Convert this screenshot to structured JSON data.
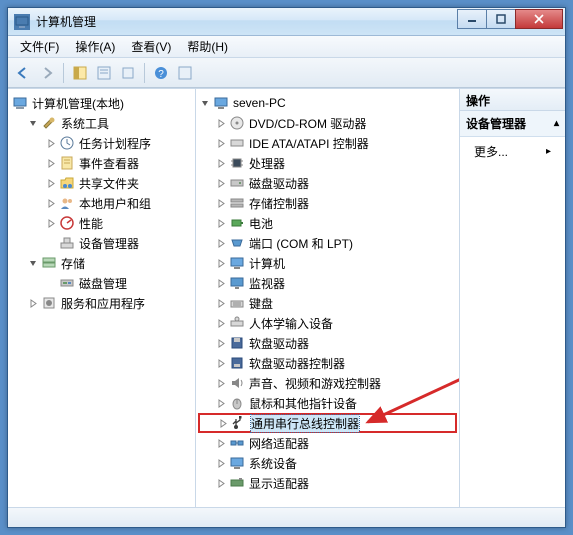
{
  "title": "计算机管理",
  "menu": {
    "file": "文件(F)",
    "action": "操作(A)",
    "view": "查看(V)",
    "help": "帮助(H)"
  },
  "left_tree": {
    "root": "计算机管理(本地)",
    "system_tools": "系统工具",
    "task_scheduler": "任务计划程序",
    "event_viewer": "事件查看器",
    "shared_folders": "共享文件夹",
    "local_users": "本地用户和组",
    "performance": "性能",
    "device_manager": "设备管理器",
    "storage": "存储",
    "disk_management": "磁盘管理",
    "services_apps": "服务和应用程序"
  },
  "mid_tree": {
    "root": "seven-PC",
    "dvd": "DVD/CD-ROM 驱动器",
    "ide": "IDE ATA/ATAPI 控制器",
    "cpu": "处理器",
    "disk": "磁盘驱动器",
    "storage_ctrl": "存储控制器",
    "battery": "电池",
    "ports": "端口 (COM 和 LPT)",
    "computer": "计算机",
    "monitor": "监视器",
    "keyboard": "键盘",
    "hid": "人体学输入设备",
    "floppy": "软盘驱动器",
    "floppy_ctrl": "软盘驱动器控制器",
    "sound": "声音、视频和游戏控制器",
    "mouse": "鼠标和其他指针设备",
    "usb": "通用串行总线控制器",
    "network": "网络适配器",
    "system": "系统设备",
    "display": "显示适配器"
  },
  "right": {
    "header": "操作",
    "section": "设备管理器",
    "more": "更多..."
  },
  "icons": {
    "triangle_open": "▾",
    "triangle_closed": "▸"
  }
}
